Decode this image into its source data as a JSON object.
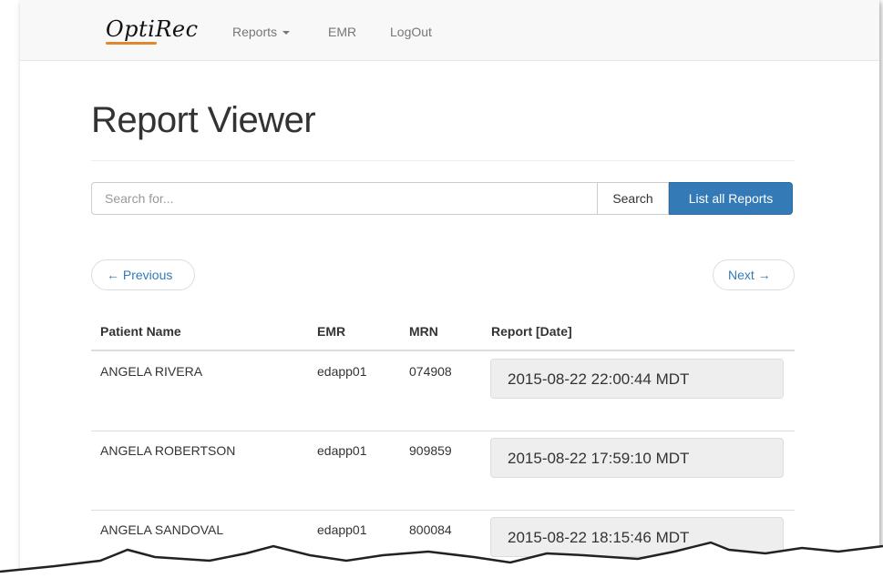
{
  "navbar": {
    "brand": "OptiRec",
    "links": [
      {
        "label": "Reports",
        "has_caret": true
      },
      {
        "label": "EMR"
      },
      {
        "label": "LogOut"
      }
    ]
  },
  "page_title": "Report Viewer",
  "search": {
    "placeholder": "Search for...",
    "value": "",
    "search_button": "Search",
    "list_all_button": "List all Reports"
  },
  "pager": {
    "previous": "← Previous",
    "next": "Next →"
  },
  "table": {
    "columns": [
      "Patient Name",
      "EMR",
      "MRN",
      "Report [Date]"
    ],
    "rows": [
      {
        "patient": "ANGELA RIVERA",
        "emr": "edapp01",
        "mrn": "074908",
        "report": "2015-08-22 22:00:44 MDT"
      },
      {
        "patient": "ANGELA ROBERTSON",
        "emr": "edapp01",
        "mrn": "909859",
        "report": "2015-08-22 17:59:10 MDT"
      },
      {
        "patient": "ANGELA SANDOVAL",
        "emr": "edapp01",
        "mrn": "800084",
        "report": "2015-08-22 18:15:46 MDT"
      }
    ]
  },
  "colors": {
    "primary": "#337ab7",
    "brand_accent": "#e0872c",
    "navbar_bg": "#f8f8f8"
  }
}
